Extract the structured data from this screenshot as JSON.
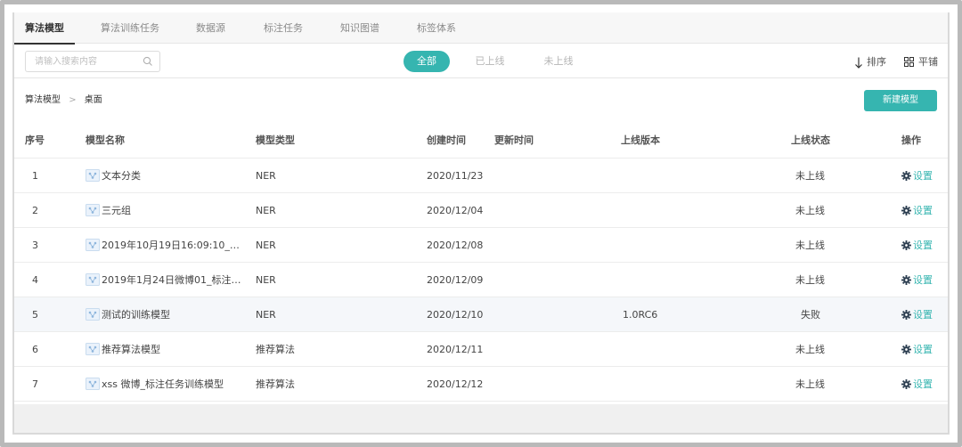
{
  "tabs": [
    {
      "label": "算法模型",
      "active": true
    },
    {
      "label": "算法训练任务",
      "active": false
    },
    {
      "label": "数据源",
      "active": false
    },
    {
      "label": "标注任务",
      "active": false
    },
    {
      "label": "知识图谱",
      "active": false
    },
    {
      "label": "标签体系",
      "active": false
    }
  ],
  "toolbar": {
    "search_placeholder": "请输入搜索内容",
    "filters": [
      {
        "label": "全部",
        "active": true
      },
      {
        "label": "已上线",
        "active": false
      },
      {
        "label": "未上线",
        "active": false
      }
    ],
    "sort_label": "排序",
    "tile_label": "平铺"
  },
  "breadcrumb": {
    "root": "算法模型",
    "separator": ">",
    "current": "桌面"
  },
  "new_model_label": "新建模型",
  "table": {
    "columns": [
      "序号",
      "模型名称",
      "模型类型",
      "创建时间",
      "更新时间",
      "上线版本",
      "上线状态",
      "操作"
    ],
    "rows": [
      {
        "index": "1",
        "name": "文本分类",
        "type": "NER",
        "created": "2020/11/23",
        "updated": "",
        "version": "",
        "status": "未上线",
        "action": "设置"
      },
      {
        "index": "2",
        "name": "三元组",
        "type": "NER",
        "created": "2020/12/04",
        "updated": "",
        "version": "",
        "status": "未上线",
        "action": "设置"
      },
      {
        "index": "3",
        "name": "2019年10月19日16:09:10_标注...",
        "type": "NER",
        "created": "2020/12/08",
        "updated": "",
        "version": "",
        "status": "未上线",
        "action": "设置"
      },
      {
        "index": "4",
        "name": "2019年1月24日微博01_标注任...",
        "type": "NER",
        "created": "2020/12/09",
        "updated": "",
        "version": "",
        "status": "未上线",
        "action": "设置"
      },
      {
        "index": "5",
        "name": "测试的训练模型",
        "type": "NER",
        "created": "2020/12/10",
        "updated": "",
        "version": "1.0RC6",
        "status": "失败",
        "action": "设置"
      },
      {
        "index": "6",
        "name": "推荐算法模型",
        "type": "推荐算法",
        "created": "2020/12/11",
        "updated": "",
        "version": "",
        "status": "未上线",
        "action": "设置"
      },
      {
        "index": "7",
        "name": "xss 微博_标注任务训练模型",
        "type": "推荐算法",
        "created": "2020/12/12",
        "updated": "",
        "version": "",
        "status": "未上线",
        "action": "设置"
      }
    ]
  },
  "colors": {
    "accent": "#36b5b0",
    "icon_blue": "#8fb6dd"
  },
  "icons": {
    "search": "search-icon",
    "sort": "arrow-down-icon",
    "tile": "grid-icon",
    "model": "model-icon",
    "settings": "gear-icon"
  }
}
